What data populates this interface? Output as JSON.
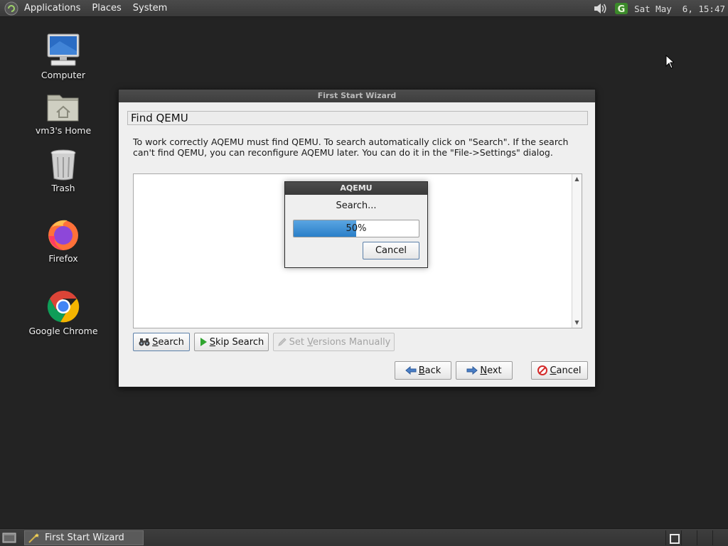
{
  "top_panel": {
    "menus": [
      "Applications",
      "Places",
      "System"
    ],
    "clock": "Sat May  6, 15:47"
  },
  "desktop": {
    "icons": [
      {
        "label": "Computer",
        "icon": "computer-icon"
      },
      {
        "label": "vm3's Home",
        "icon": "home-folder-icon"
      },
      {
        "label": "Trash",
        "icon": "trash-icon"
      },
      {
        "label": "Firefox",
        "icon": "firefox-icon"
      },
      {
        "label": "Google Chrome",
        "icon": "chrome-icon"
      }
    ]
  },
  "wizard": {
    "title": "First Start Wizard",
    "header": "Find QEMU",
    "description": "To work correctly AQEMU must find QEMU. To search automatically click on \"Search\". If the search can't find QEMU, you can reconfigure AQEMU later. You can do it in the \"File->Settings\" dialog.",
    "buttons": {
      "search": {
        "mnemonic": "S",
        "rest": "earch"
      },
      "skip_search": {
        "mnemonic": "S",
        "rest_pre": "",
        "rest": "kip Search"
      },
      "set_versions": {
        "pre": "Set ",
        "mnemonic": "V",
        "rest": "ersions Manually"
      },
      "back": {
        "mnemonic": "B",
        "rest": "ack"
      },
      "next": {
        "mnemonic": "N",
        "rest": "ext"
      },
      "cancel": {
        "mnemonic": "C",
        "rest": "ancel"
      }
    }
  },
  "progress_dialog": {
    "title": "AQEMU",
    "message": "Search...",
    "progress_percent": 50,
    "progress_label": "50%",
    "cancel_label": "Cancel"
  },
  "taskbar": {
    "tasks": [
      {
        "label": "First Start Wizard",
        "active": true
      }
    ],
    "workspaces": 4,
    "active_workspace": 1
  },
  "colors": {
    "desktop_bg": "#232323",
    "progress_fill": "#2a7fc8"
  }
}
